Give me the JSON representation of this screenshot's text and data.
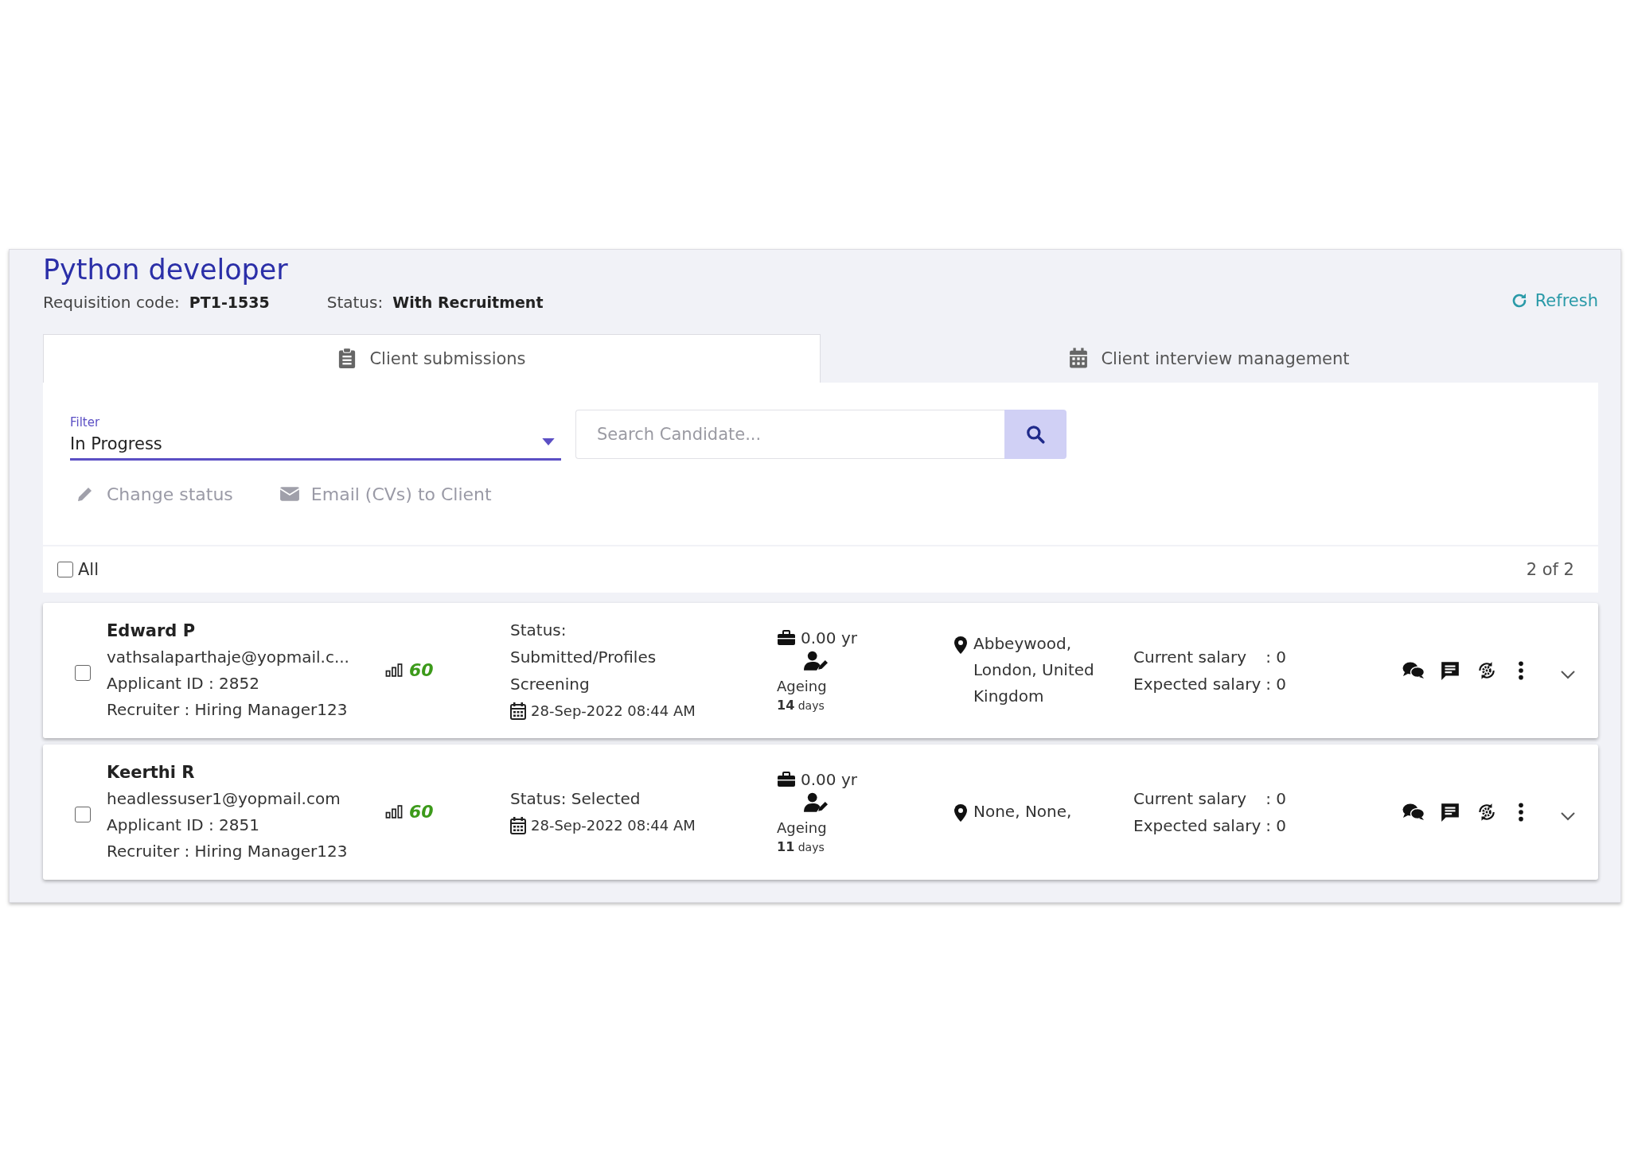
{
  "job": {
    "title": "Python developer",
    "requisition_label": "Requisition code:",
    "requisition_code": "PT1-1535",
    "status_label": "Status:",
    "status": "With Recruitment",
    "refresh": "Refresh"
  },
  "tabs": [
    {
      "label": "Client submissions",
      "kind": "clipboard",
      "selected": true
    },
    {
      "label": "Client interview management",
      "kind": "calendar",
      "selected": false
    }
  ],
  "filter": {
    "label": "Filter",
    "value": "In Progress"
  },
  "search": {
    "placeholder": "Search Candidate..."
  },
  "actions": [
    {
      "label": "Change status",
      "kind": "edit"
    },
    {
      "label": "Email (CVs) to Client",
      "kind": "email"
    }
  ],
  "select_all": {
    "label": "All",
    "checked": false
  },
  "count": "2 of 2",
  "candidates": [
    {
      "name": "Edward P",
      "email": "vathsalaparthaje@yopmail.c...",
      "applicant_id": "Applicant ID : 2852",
      "recruiter": "Recruiter : Hiring Manager123",
      "score": "60",
      "status": "Status: Submitted/Profiles Screening",
      "date": "28-Sep-2022 08:44 AM",
      "experience": "0.00 yr",
      "ageing_label": "Ageing",
      "ageing_days": "14",
      "ageing_unit": "days",
      "location": "Abbeywood, London, United Kingdom",
      "current_salary_label": "Current salary",
      "current_salary": ": 0",
      "expected_salary_label": "Expected salary",
      "expected_salary": ": 0",
      "checked": false
    },
    {
      "name": "Keerthi R",
      "email": "headlessuser1@yopmail.com",
      "applicant_id": "Applicant ID : 2851",
      "recruiter": "Recruiter : Hiring Manager123",
      "score": "60",
      "status": "Status: Selected",
      "date": "28-Sep-2022 08:44 AM",
      "experience": "0.00 yr",
      "ageing_label": "Ageing",
      "ageing_days": "11",
      "ageing_unit": "days",
      "location": "None, None,",
      "current_salary_label": "Current salary",
      "current_salary": ": 0",
      "expected_salary_label": "Expected salary",
      "expected_salary": ": 0",
      "checked": false
    }
  ]
}
